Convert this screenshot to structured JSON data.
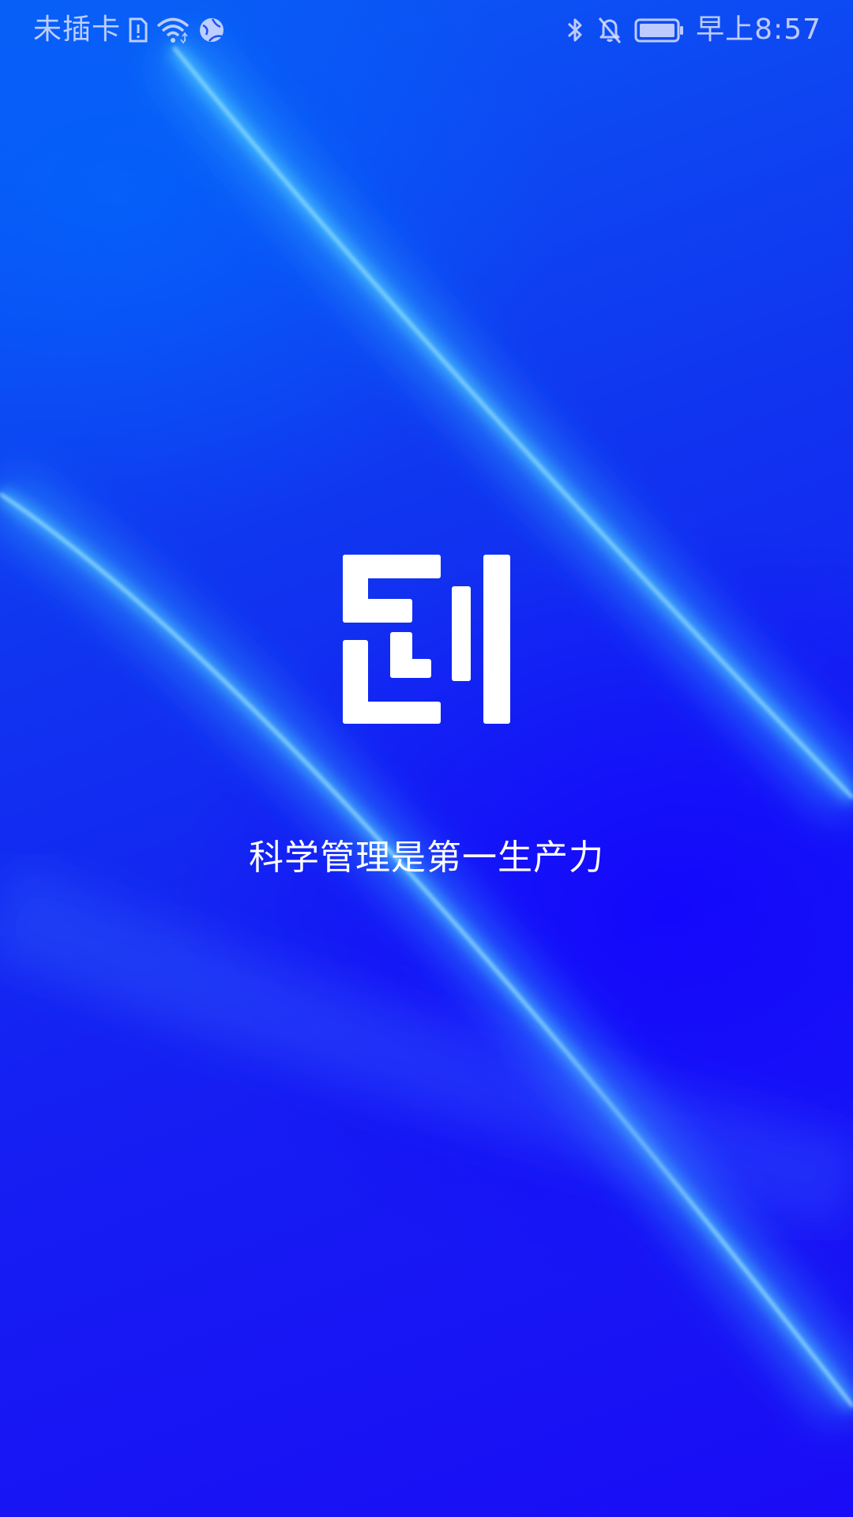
{
  "status_bar": {
    "carrier": "未插卡",
    "time": "早上8:57",
    "icons_left": [
      "sim-alert-icon",
      "wifi-icon",
      "vpn-globe-icon"
    ],
    "icons_right": [
      "bluetooth-icon",
      "bell-muted-icon",
      "battery-icon"
    ]
  },
  "splash": {
    "logo_icon": "app-logo-icon",
    "slogan": "科学管理是第一生产力"
  },
  "colors": {
    "background_primary": "#1b2cf2",
    "background_light": "#0a5cf5",
    "background_deep": "#1a0cf6",
    "streak": "#5fd0ff",
    "text": "#ffffff"
  }
}
